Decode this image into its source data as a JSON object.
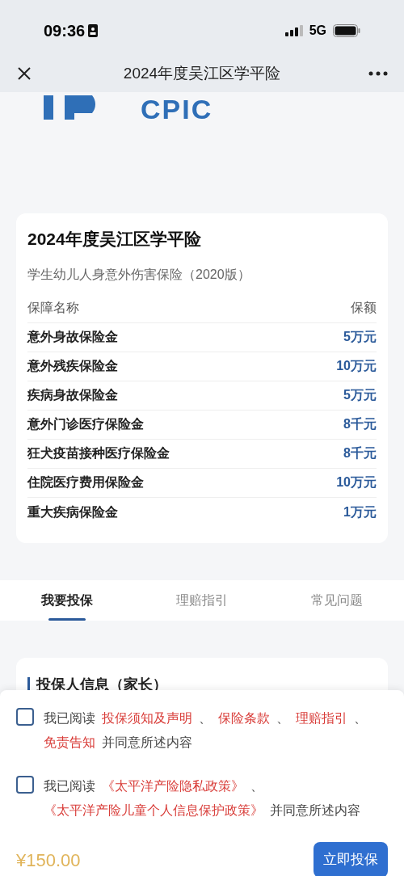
{
  "status_bar": {
    "time": "09:36",
    "network": "5G"
  },
  "header": {
    "title": "2024年度吴江区学平险"
  },
  "logo": {
    "text": "CPIC"
  },
  "plan_card": {
    "title": "2024年度吴江区学平险",
    "subtitle": "学生幼儿人身意外伤害保险（2020版）",
    "columns": [
      "保障名称",
      "保额"
    ],
    "rows": [
      {
        "name": "意外身故保险金",
        "amount": "5万元"
      },
      {
        "name": "意外残疾保险金",
        "amount": "10万元"
      },
      {
        "name": "疾病身故保险金",
        "amount": "5万元"
      },
      {
        "name": "意外门诊医疗保险金",
        "amount": "8千元"
      },
      {
        "name": "狂犬疫苗接种医疗保险金",
        "amount": "8千元"
      },
      {
        "name": "住院医疗费用保险金",
        "amount": "10万元"
      },
      {
        "name": "重大疾病保险金",
        "amount": "1万元"
      }
    ]
  },
  "tabs": [
    {
      "label": "我要投保",
      "selected": true
    },
    {
      "label": "理赔指引",
      "selected": false
    },
    {
      "label": "常见问题",
      "selected": false
    }
  ],
  "form_card": {
    "section_title": "投保人信息（家长）"
  },
  "agreements": [
    {
      "checked": false,
      "parts": [
        {
          "kind": "text",
          "text": "我已阅读"
        },
        {
          "kind": "link",
          "text": "投保须知及声明"
        },
        {
          "kind": "text",
          "text": "、"
        },
        {
          "kind": "link",
          "text": "保险条款"
        },
        {
          "kind": "text",
          "text": "、"
        },
        {
          "kind": "link",
          "text": "理赔指引"
        },
        {
          "kind": "text",
          "text": "、"
        },
        {
          "kind": "link",
          "text": "免责告知"
        },
        {
          "kind": "text",
          "text": "并同意所述内容"
        }
      ]
    },
    {
      "checked": false,
      "parts": [
        {
          "kind": "text",
          "text": "我已阅读"
        },
        {
          "kind": "link",
          "text": "《太平洋产险隐私政策》"
        },
        {
          "kind": "text",
          "text": "、"
        },
        {
          "kind": "link",
          "text": "《太平洋产险儿童个人信息保护政策》"
        },
        {
          "kind": "text",
          "text": "并同意所述内容"
        }
      ]
    }
  ],
  "footer": {
    "price": "¥150.00",
    "button": "立即投保"
  }
}
